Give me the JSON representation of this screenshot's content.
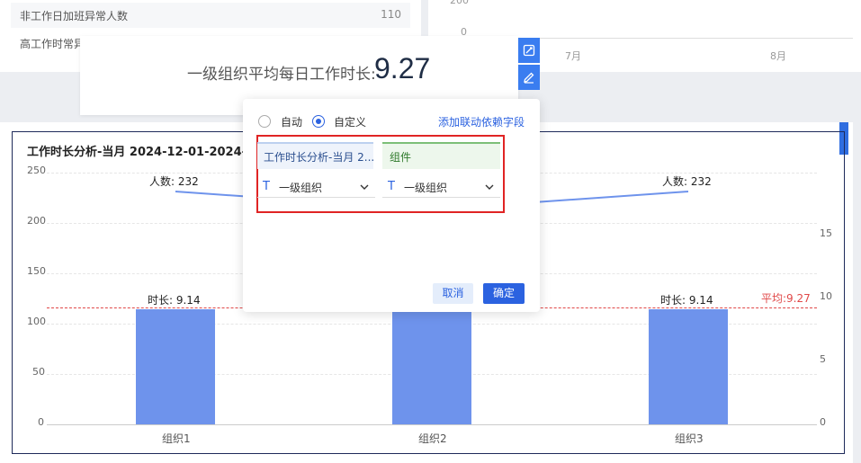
{
  "top_table": {
    "rows": [
      {
        "label": "非工作日加班异常人数",
        "value": "110"
      },
      {
        "label": "高工作时常异",
        "value": ""
      }
    ]
  },
  "top_right_chart": {
    "y_ticks": [
      "200",
      "0"
    ],
    "x_ticks": [
      "7月",
      "8月"
    ]
  },
  "kpi": {
    "label": "一级组织平均每日工作时长:",
    "value": "9.27"
  },
  "side_buttons": [
    "link-edit-icon",
    "pencil-icon"
  ],
  "popup": {
    "mode_auto_label": "自动",
    "mode_custom_label": "自定义",
    "selected_mode": "custom",
    "add_link_label": "添加联动依赖字段",
    "source_label": "工作时长分析-当月 2...",
    "target_label": "组件",
    "source_field": "一级组织",
    "target_field": "一级组织",
    "cancel_label": "取消",
    "ok_label": "确定",
    "field_type_icon": "text-type-icon"
  },
  "chart_data": {
    "type": "bar",
    "title": "工作时长分析-当月 2024-12-01-2024-",
    "categories": [
      "组织1",
      "组织2",
      "组织3"
    ],
    "series": [
      {
        "values": [
          9.14,
          9.14,
          9.14
        ],
        "label_prefix": "时长: ",
        "axis": "right",
        "color": "#6e93ec"
      },
      {
        "values": [
          232,
          232,
          232
        ],
        "label_prefix": "人数: ",
        "axis": "left",
        "color": "#6e93ec"
      }
    ],
    "left_axis": {
      "ylim": [
        0,
        250
      ],
      "ticks": [
        "250",
        "200",
        "150",
        "100",
        "50",
        "0"
      ]
    },
    "right_axis": {
      "ylim": [
        0,
        20
      ],
      "ticks": [
        "15",
        "10",
        "5",
        "0"
      ]
    },
    "avg_line": {
      "value": 9.27,
      "label": "平均:9.27",
      "color": "#e04848"
    },
    "grid": true
  },
  "colors": {
    "accent": "#2b62e0",
    "highlight_border": "#e02424"
  }
}
